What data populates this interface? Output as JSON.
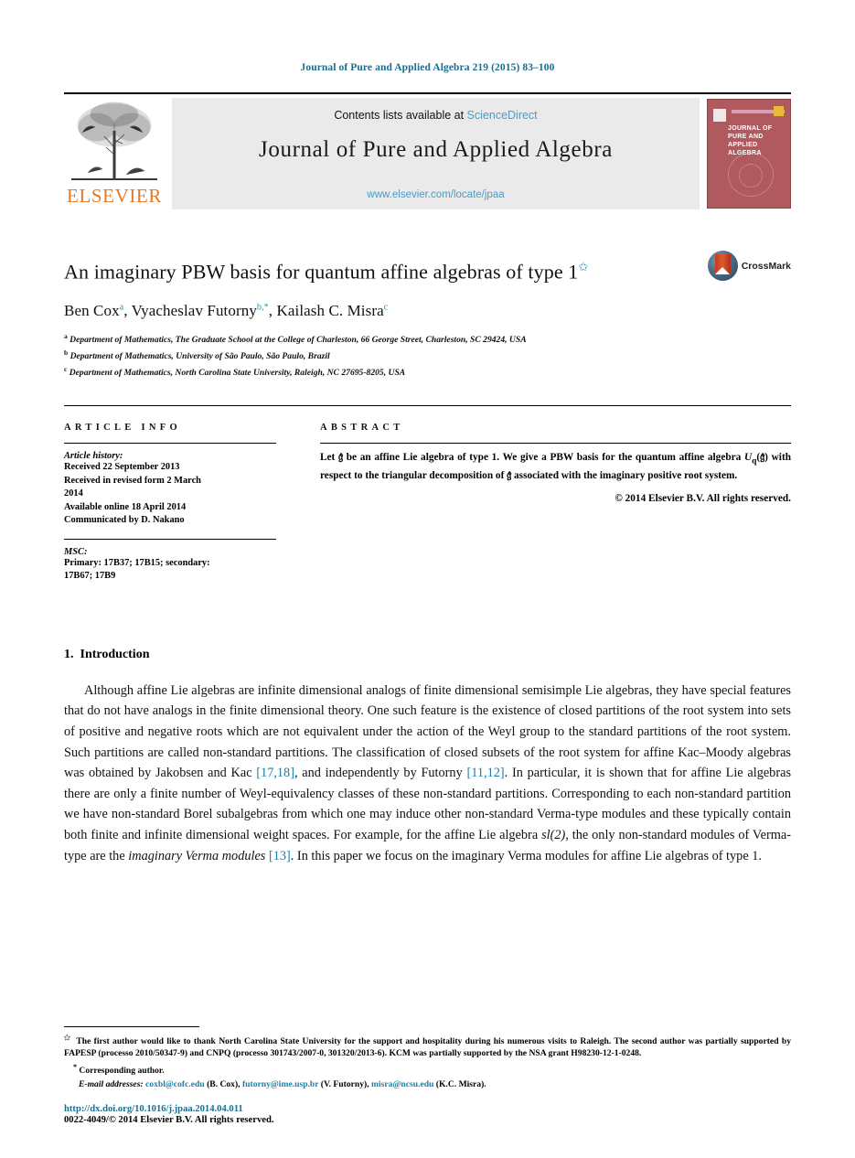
{
  "running_head": "Journal of Pure and Applied Algebra 219 (2015) 83–100",
  "masthead": {
    "contents_prefix": "Contents lists available at ",
    "sciencedirect": "ScienceDirect",
    "journal_title": "Journal of Pure and Applied Algebra",
    "journal_url": "www.elsevier.com/locate/jpaa",
    "publisher": "ELSEVIER",
    "cover_title": "JOURNAL OF\nPURE AND\nAPPLIED ALGEBRA",
    "cover_color": "#b05a5f",
    "accent_color": "#1a6e8e",
    "link_color": "#4a9cc7",
    "elsevier_orange": "#E87722"
  },
  "article": {
    "title": "An imaginary PBW basis for quantum affine algebras of type 1",
    "title_footnote_marker": "✩",
    "crossmark_label": "CrossMark",
    "authors": [
      {
        "name": "Ben Cox",
        "marks": "a"
      },
      {
        "name": "Vyacheslav Futorny",
        "marks": "b,*"
      },
      {
        "name": "Kailash C. Misra",
        "marks": "c"
      }
    ],
    "affiliations": [
      {
        "mark": "a",
        "text": "Department of Mathematics, The Graduate School at the College of Charleston, 66 George Street, Charleston, SC 29424, USA"
      },
      {
        "mark": "b",
        "text": "Department of Mathematics, University of São Paulo, São Paulo, Brazil"
      },
      {
        "mark": "c",
        "text": "Department of Mathematics, North Carolina State University, Raleigh, NC 27695-8205, USA"
      }
    ]
  },
  "info": {
    "heading": "ARTICLE INFO",
    "history_label": "Article history:",
    "history_lines": [
      "Received 22 September 2013",
      "Received in revised form 2 March",
      "2014",
      "Available online 18 April 2014",
      "Communicated by D. Nakano"
    ],
    "msc_label": "MSC:",
    "msc_lines": [
      "Primary: 17B37; 17B15; secondary:",
      "17B67; 17B9"
    ]
  },
  "abstract": {
    "heading": "ABSTRACT",
    "text_part1": "Let ",
    "gothic_g": "𝔤̂",
    "text_part2": " be an affine Lie algebra of type 1. We give a PBW basis for the quantum affine algebra ",
    "uq": "U",
    "uq_sub": "q",
    "uq_arg": "(𝔤̂)",
    "text_part3": " with respect to the triangular decomposition of ",
    "text_part4": " associated with the imaginary positive root system.",
    "copyright": "© 2014 Elsevier B.V. All rights reserved."
  },
  "introduction": {
    "number": "1.",
    "heading": "Introduction",
    "paragraph_segments": [
      {
        "t": "Although affine Lie algebras are infinite dimensional analogs of finite dimensional semisimple Lie algebras, they have special features that do not have analogs in the finite dimensional theory. One such feature is the existence of closed partitions of the root system into sets of positive and negative roots which are not equivalent under the action of the Weyl group to the standard partitions of the root system. Such partitions are called non-standard partitions. The classification of closed subsets of the root system for affine Kac–Moody algebras was obtained by Jakobsen and Kac ",
        "k": "text"
      },
      {
        "t": "[17,18]",
        "k": "cite"
      },
      {
        "t": ", and independently by Futorny ",
        "k": "text"
      },
      {
        "t": "[11,12]",
        "k": "cite"
      },
      {
        "t": ". In particular, it is shown that for affine Lie algebras there are only a finite number of Weyl-equivalency classes of these non-standard partitions. Corresponding to each non-standard partition we have non-standard Borel subalgebras from which one may induce other non-standard Verma-type modules and these typically contain both finite and infinite dimensional weight spaces. For example, for the affine Lie algebra ",
        "k": "text"
      },
      {
        "t": "sl(2)",
        "k": "math"
      },
      {
        "t": ", the only non-standard modules of Verma-type are the ",
        "k": "text"
      },
      {
        "t": "imaginary Verma modules",
        "k": "italic"
      },
      {
        "t": " ",
        "k": "text"
      },
      {
        "t": "[13]",
        "k": "cite"
      },
      {
        "t": ". In this paper we focus on the imaginary Verma modules for affine Lie algebras of type 1.",
        "k": "text"
      }
    ]
  },
  "footnotes": {
    "star_marker": "✩",
    "funding": "The first author would like to thank North Carolina State University for the support and hospitality during his numerous visits to Raleigh. The second author was partially supported by FAPESP (processo 2010/50347-9) and CNPQ (processo 301743/2007-0, 301320/2013-6). KCM was partially supported by the NSA grant H98230-12-1-0248.",
    "corresponding_marker": "*",
    "corresponding": "Corresponding author.",
    "email_label": "E-mail addresses:",
    "emails": [
      {
        "address": "coxbl@cofc.edu",
        "who": "(B. Cox)"
      },
      {
        "address": "futorny@ime.usp.br",
        "who": "(V. Futorny)"
      },
      {
        "address": "misra@ncsu.edu",
        "who": "(K.C. Misra)"
      }
    ]
  },
  "bottom": {
    "doi": "http://dx.doi.org/10.1016/j.jpaa.2014.04.011",
    "issn_line": "0022-4049/© 2014 Elsevier B.V. All rights reserved."
  }
}
